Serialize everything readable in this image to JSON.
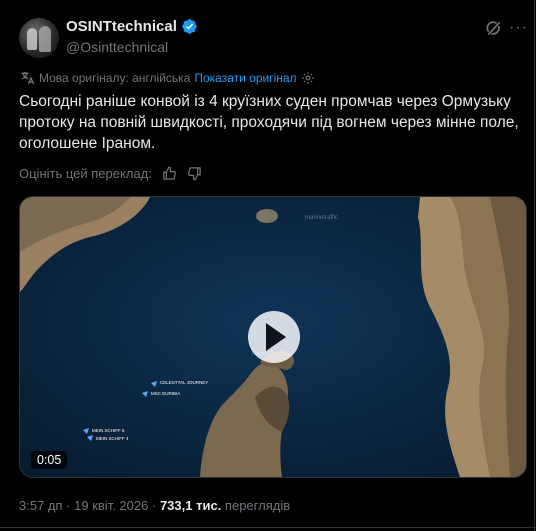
{
  "author": {
    "name": "OSINTtechnical",
    "handle": "@Osinttechnical"
  },
  "translation": {
    "source_note": "Мова оригіналу: англійська",
    "show_original": "Показати оригінал",
    "rate_prompt": "Оцініть цей переклад:"
  },
  "tweet": {
    "text": "Сьогодні раніше конвой із 4 круїзних суден промчав через Ормузьку протоку на повній швидкості, проходячи під вогнем через мінне поле, оголошене Іраном."
  },
  "media": {
    "duration": "0:05",
    "ships": [
      {
        "name": "CELESTYAL JOURNEY"
      },
      {
        "name": "MSC EURIBIA"
      },
      {
        "name": "MEIN SCHIFF 5"
      },
      {
        "name": "MEIN SCHIFF 4"
      }
    ],
    "watermark": "marinetraffic"
  },
  "meta": {
    "time": "3:57 дп",
    "sep": "·",
    "date": "19 квіт. 2026",
    "views_count": "733,1 тис.",
    "views_label": "переглядів"
  },
  "colors": {
    "accent": "#1d9bf0",
    "muted": "#71767b",
    "text": "#e7e9ea",
    "background": "#000000"
  },
  "icons": [
    "verified-badge-icon",
    "grok-icon",
    "more-icon",
    "translate-icon",
    "settings-gear-icon",
    "thumbs-up-icon",
    "thumbs-down-icon",
    "play-icon"
  ]
}
